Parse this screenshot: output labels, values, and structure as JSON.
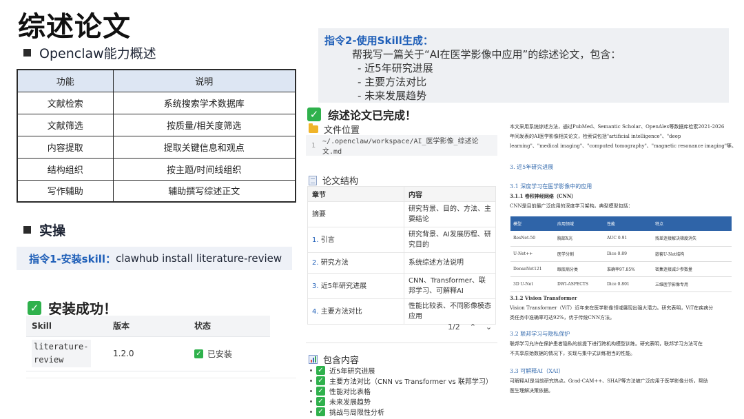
{
  "title": "综述论文",
  "section_ability": "Openclaw能力概述",
  "ability_table": {
    "headers": [
      "功能",
      "说明"
    ],
    "rows": [
      [
        "文献检索",
        "系统搜索学术数据库"
      ],
      [
        "文献筛选",
        "按质量/相关度筛选"
      ],
      [
        "内容提取",
        "提取关键信息和观点"
      ],
      [
        "结构组织",
        "按主题/时间线组织"
      ],
      [
        "写作辅助",
        "辅助撰写综述正文"
      ]
    ]
  },
  "section_practice": "实操",
  "command1": {
    "label": "指令1-安装skill：",
    "value": "clawhub install literature-review"
  },
  "install": {
    "title": "安装成功！",
    "headers": [
      "Skill",
      "版本",
      "状态"
    ],
    "skill": "literature-review",
    "version": "1.2.0",
    "status": "已安装"
  },
  "command2": {
    "label": "指令2-使用Skill生成：",
    "prompt": "帮我写一篇关于“AI在医学影像中应用”的综述论文，包含：",
    "bullets": [
      "- 近5年研究进展",
      "- 主要方法对比",
      "- 未来发展趋势"
    ]
  },
  "result": {
    "done_title": "综述论文已完成！",
    "file_location_label": "文件位置",
    "code_line_no": "1",
    "file_path": "~/.openclaw/workspace/AI_医学影像_综述论文.md",
    "structure_label": "论文结构",
    "structure_headers": [
      "章节",
      "内容"
    ],
    "structure_rows": [
      {
        "num": "",
        "section": "摘要",
        "content": "研究背景、目的、方法、主要结论"
      },
      {
        "num": "1.",
        "section": "引言",
        "content": "研究背景、AI发展历程、研究目的"
      },
      {
        "num": "2.",
        "section": "研究方法",
        "content": "系统综述方法说明"
      },
      {
        "num": "3.",
        "section": "近5年研究进展",
        "content": "CNN、Transformer、联邦学习、可解释AI"
      },
      {
        "num": "4.",
        "section": "主要方法对比",
        "content": "性能比较表、不同影像模态应用"
      }
    ],
    "pager": "1/2",
    "contains_label": "包含内容",
    "contains": [
      "近5年研究进展",
      "主要方法对比（CNN vs Transformer vs 联邦学习）",
      "性能对比表格",
      "未来发展趋势",
      "挑战与局限性分析"
    ]
  },
  "document": {
    "intro_lines": [
      "本文采用系统综述方法，通过PubMed、Semantic Scholar、OpenAlex等数据库检索2021-2026",
      "年间发表的AI医学影像相关论文，检索词包括\"artificial intelligence\"、\"deep",
      "learning\"、\"medical imaging\"、\"computed tomography\"、\"magnetic resonance imaging\"等。"
    ],
    "h3": "3. 近5年研究进展",
    "h31": "3.1 深度学习在医学影像中的应用",
    "h311": "3.1.1 卷积神经网络（CNN）",
    "cnn_text": "CNN是目前最广泛应用的深度学习架构。典型模型包括：",
    "table_headers": [
      "模型",
      "应用领域",
      "性能",
      "特点"
    ],
    "table_rows": [
      [
        "ResNet-50",
        "胸部X光",
        "AUC 0.91",
        "残差连接解决梯度消失"
      ],
      [
        "U-Net++",
        "医学分割",
        "Dice 0.89",
        "嵌套U-Net结构"
      ],
      [
        "DenseNet121",
        "眼底病分类",
        "准确率97.85%",
        "密集连接减少参数量"
      ],
      [
        "3D U-Net",
        "DWI-ASPECTS",
        "Dice 0.801",
        "三维医学影像专用"
      ]
    ],
    "h312": "3.1.2 Vision Transformer",
    "vit_lines": [
      "Vision Transformer（ViT）近年来在医学影像领域展现出强大潜力。研究表明，ViT在疾病分",
      "类任务中准确率可达92%，优于传统CNN方法。"
    ],
    "h32": "3.2 联邦学习与隐私保护",
    "fl_lines": [
      "联邦学习允许在保护患者隐私的前提下进行跨机构模型训练。研究表明，联邦学习方法可在",
      "不共享原始数据的情况下，实现与集中式训练相当的性能。"
    ],
    "h33": "3.3 可解释AI（XAI）",
    "xai_lines": [
      "可解释AI是当前研究热点。Grad-CAM++、SHAP等方法被广泛应用于医学影像分析，帮助",
      "医生理解决策依据。"
    ]
  }
}
